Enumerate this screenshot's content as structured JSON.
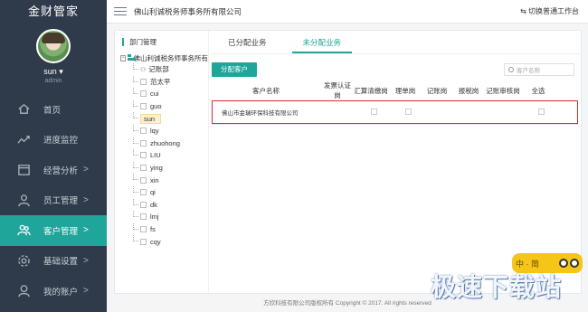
{
  "app": {
    "brand": "金财管家"
  },
  "user": {
    "name": "sun ▾",
    "role": "admin"
  },
  "sidebar": {
    "items": [
      {
        "label": "首页",
        "icon": "home-icon",
        "chevron": ""
      },
      {
        "label": "进度监控",
        "icon": "trend-icon",
        "chevron": ""
      },
      {
        "label": "经营分析",
        "icon": "calendar-icon",
        "chevron": ">"
      },
      {
        "label": "员工管理",
        "icon": "person-icon",
        "chevron": ">"
      },
      {
        "label": "客户管理",
        "icon": "group-icon",
        "chevron": ">"
      },
      {
        "label": "基础设置",
        "icon": "gear-icon",
        "chevron": ">"
      },
      {
        "label": "我的账户",
        "icon": "account-icon",
        "chevron": ">"
      }
    ],
    "active_index": 4
  },
  "topbar": {
    "company": "佛山利诚税务师事务所有限公司",
    "switch_label": "⇆ 切换普通工作台"
  },
  "dept": {
    "title": "部门管理",
    "root": "佛山利诚税务师事务所有",
    "root_toggle": "−",
    "items": [
      "记账部",
      "范太平",
      "cui",
      "guo",
      "sun",
      "lqy",
      "zhuohong",
      "LIU",
      "ying",
      "xin",
      "qi",
      "dk",
      "lmj",
      "fs",
      "cqy"
    ],
    "selected": "sun"
  },
  "tabs": [
    {
      "label": "已分配业务"
    },
    {
      "label": "未分配业务"
    }
  ],
  "active_tab": 1,
  "actions": {
    "assign_label": "分配客户",
    "search_placeholder": "客户名称"
  },
  "table": {
    "headers": [
      "客户名称",
      "发票认证岗",
      "汇算清缴岗",
      "理单岗",
      "记账岗",
      "报税岗",
      "记账审核岗",
      "全选"
    ],
    "rows": [
      {
        "name": "佛山市金瑞环保科技有限公司"
      }
    ]
  },
  "footer": {
    "text": "方欣科技有限公司版权所有 Copyright © 2017. All rights reserved"
  },
  "watermark": {
    "badge": "中 · 简",
    "text": "极速下载站"
  },
  "colors": {
    "accent": "#1fa59a",
    "sidebar_bg": "#2f3b4a",
    "highlight": "#e02a2a"
  }
}
